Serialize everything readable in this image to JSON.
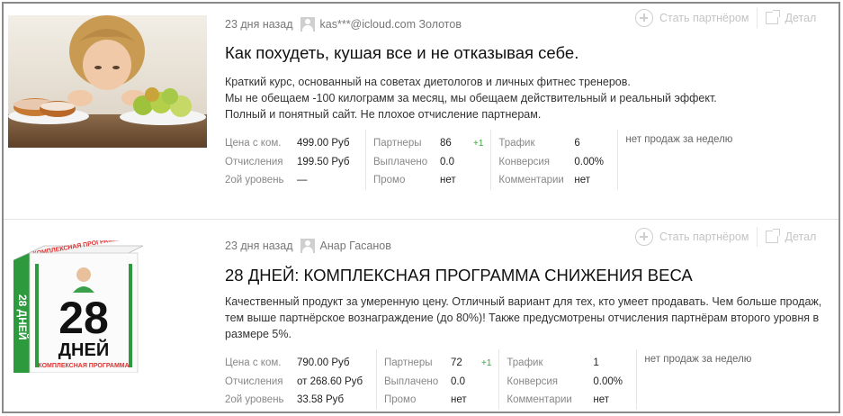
{
  "colors": {
    "border": "#8a8a8a",
    "muted": "#777777",
    "accent_green": "#3aa53a"
  },
  "actions": {
    "partner_label": "Стать партнёром",
    "details_label": "Детал",
    "plus_icon": "plus-circle-icon",
    "external_icon": "external-link-icon"
  },
  "products": [
    {
      "date": "23 дня назад",
      "author": "kas***@icloud.com Золотов",
      "title": "Как похудеть, кушая все и не отказывая себе.",
      "desc": [
        "Краткий курс, основанный на советах диетологов и личных фитнес тренеров.",
        "Мы не обещаем -100 килограмм за месяц, мы обещаем действительный и реальный эффект.",
        "Полный и понятный сайт. Не плохое отчисление партнерам."
      ],
      "stats": {
        "price_label": "Цена с ком.",
        "price": "499.00 Руб",
        "commission_label": "Отчисления",
        "commission": "199.50 Руб",
        "level2_label": "2ой уровень",
        "level2": "—",
        "partners_label": "Партнеры",
        "partners": "86",
        "partners_delta": "+1",
        "paid_label": "Выплачено",
        "paid": "0.0",
        "promo_label": "Промо",
        "promo": "нет",
        "traffic_label": "Трафик",
        "traffic": "6",
        "conversion_label": "Конверсия",
        "conversion": "0.00%",
        "comments_label": "Комментарии",
        "comments": "нет",
        "sales_note": "нет продаж за неделю"
      }
    },
    {
      "date": "23 дня назад",
      "author": "Анар Гасанов",
      "title": "28 ДНЕЙ: КОМПЛЕКСНАЯ ПРОГРАММА СНИЖЕНИЯ ВЕСА",
      "desc": [
        "Качественный продукт за умеренную цену. Отличный вариант для тех, кто умеет продавать. Чем больше продаж, тем выше партнёрское вознаграждение (до 80%)! Также предусмотрены отчисления партнёрам второго уровня в размере 5%."
      ],
      "box_top": "КОМПЛЕКСНАЯ ПРОГРАММА СНИЖЕНИЯ ВЕСА",
      "box_num": "28",
      "box_word": "ДНЕЙ",
      "box_side": "28 ДНЕЙ",
      "box_bottom": "КОМПЛЕКСНАЯ ПРОГРАММА",
      "stats": {
        "price_label": "Цена с ком.",
        "price": "790.00 Руб",
        "commission_label": "Отчисления",
        "commission": "от 268.60 Руб",
        "level2_label": "2ой уровень",
        "level2": "33.58 Руб",
        "partners_label": "Партнеры",
        "partners": "72",
        "partners_delta": "+1",
        "paid_label": "Выплачено",
        "paid": "0.0",
        "promo_label": "Промо",
        "promo": "нет",
        "traffic_label": "Трафик",
        "traffic": "1",
        "conversion_label": "Конверсия",
        "conversion": "0.00%",
        "comments_label": "Комментарии",
        "comments": "нет",
        "sales_note": "нет продаж за неделю"
      }
    }
  ]
}
